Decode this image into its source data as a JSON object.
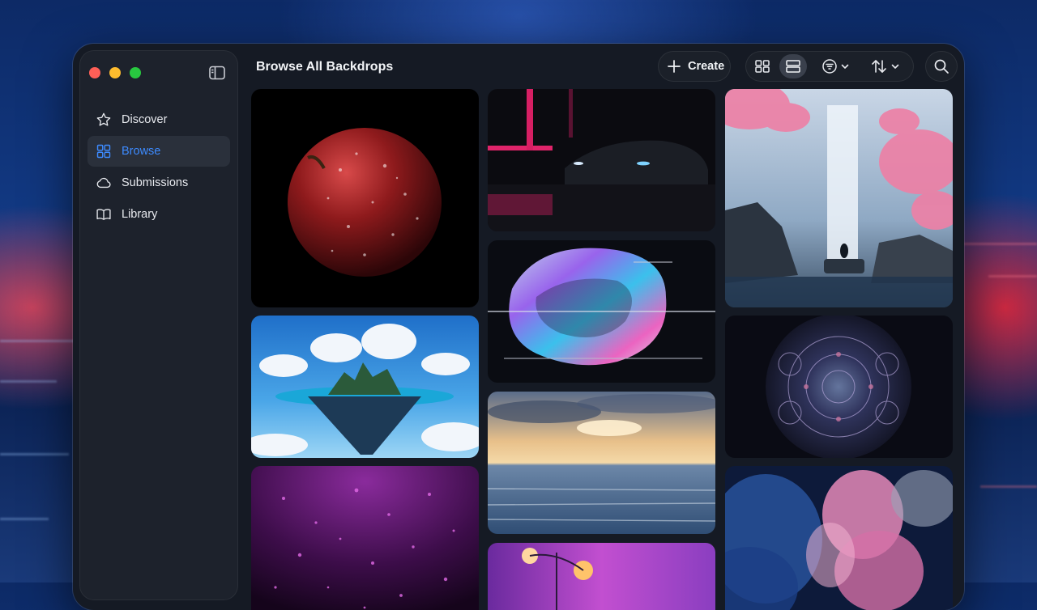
{
  "window": {
    "title": "Browse All Backdrops"
  },
  "sidebar": {
    "items": [
      {
        "label": "Discover",
        "icon": "star-icon",
        "active": false
      },
      {
        "label": "Browse",
        "icon": "grid-icon",
        "active": true
      },
      {
        "label": "Submissions",
        "icon": "cloud-icon",
        "active": false
      },
      {
        "label": "Library",
        "icon": "book-icon",
        "active": false
      }
    ]
  },
  "toolbar": {
    "create_label": "Create",
    "active_view": "rows"
  },
  "colors": {
    "accent": "#3d8bff",
    "window_bg": "#151a24",
    "sidebar_bg": "#1d222c",
    "traffic_red": "#ff5f57",
    "traffic_yellow": "#febc2e",
    "traffic_green": "#28c840"
  },
  "backdrops": [
    {
      "subject": "red-apple",
      "icon": "apple-image"
    },
    {
      "subject": "floating-island",
      "icon": "island-image"
    },
    {
      "subject": "purple-particles",
      "icon": "particles-image"
    },
    {
      "subject": "neon-car",
      "icon": "car-image"
    },
    {
      "subject": "iridescent-glass",
      "icon": "glass-image"
    },
    {
      "subject": "ocean-sunset",
      "icon": "sunset-image"
    },
    {
      "subject": "pink-streetlight",
      "icon": "streetlight-image"
    },
    {
      "subject": "waterfall-blossoms",
      "icon": "waterfall-image"
    },
    {
      "subject": "kaleidoscope",
      "icon": "kaleidoscope-image"
    },
    {
      "subject": "smoke-ink",
      "icon": "smoke-image"
    }
  ]
}
